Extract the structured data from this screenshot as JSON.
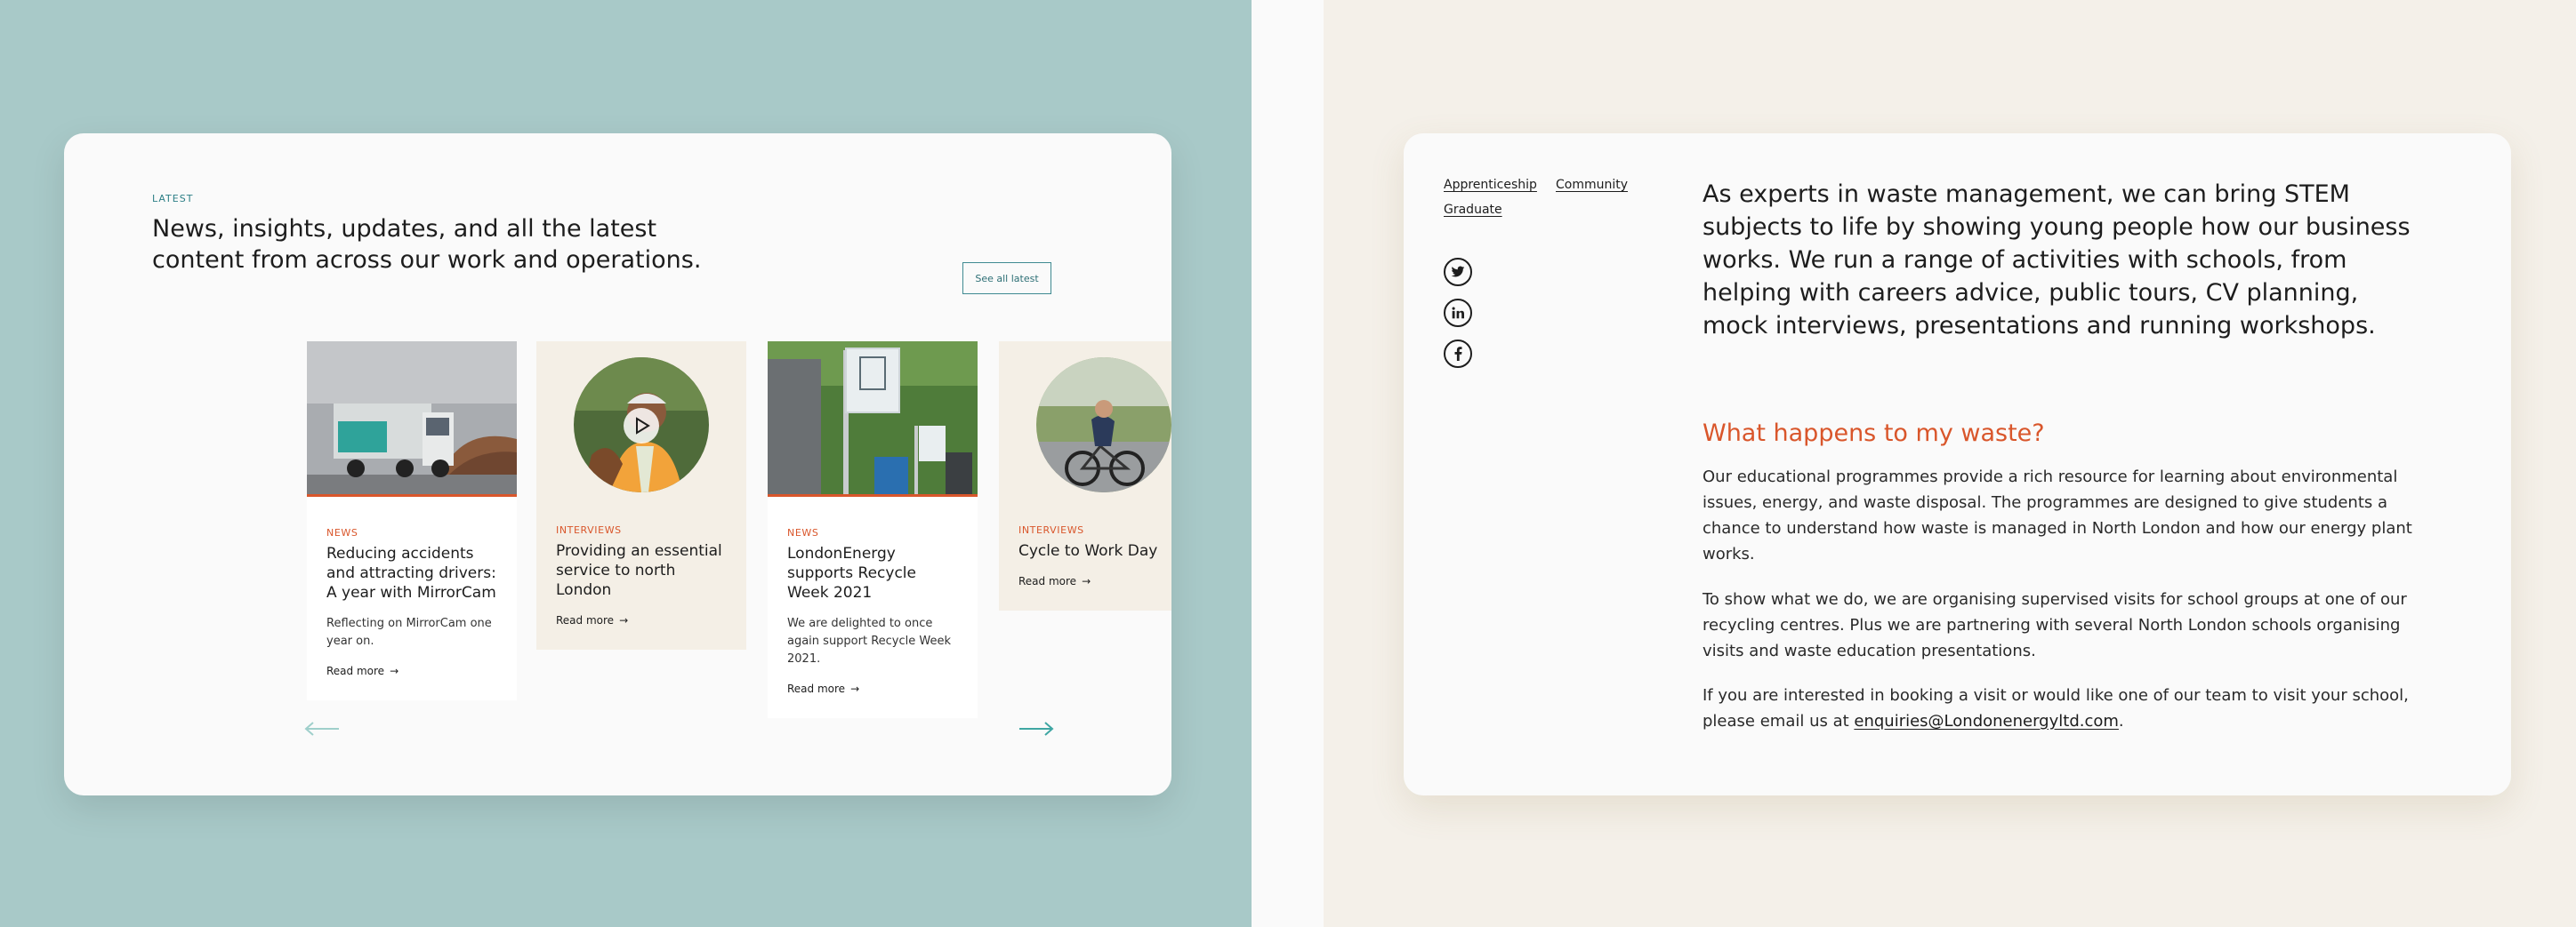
{
  "colors": {
    "teal_background": "#a8c9c8",
    "beige_background": "#f4f0e9",
    "accent_orange": "#d9562b",
    "accent_teal": "#2d7f86",
    "panel": "#fafafa"
  },
  "latest": {
    "eyebrow": "LATEST",
    "title": "News, insights, updates, and all the latest content from across our work and operations.",
    "see_all_label": "See all latest",
    "cards": [
      {
        "category": "NEWS",
        "title": "Reducing accidents and attracting drivers: A year with MirrorCam",
        "description": "Reflecting on MirrorCam one year on.",
        "read_more": "Read more",
        "image": "recycling-truck-photo"
      },
      {
        "category": "INTERVIEWS",
        "title": "Providing an essential service to north London",
        "read_more": "Read more",
        "image": "worker-portrait-photo"
      },
      {
        "category": "NEWS",
        "title": "LondonEnergy supports Recycle Week 2021",
        "description": "We are delighted to once again support Recycle Week 2021.",
        "read_more": "Read more",
        "image": "recycling-signs-photo"
      },
      {
        "category": "INTERVIEWS",
        "title": "Cycle to Work Day",
        "read_more": "Read more",
        "image": "cyclist-portrait-photo"
      }
    ],
    "prev_icon": "arrow-left-icon",
    "next_icon": "arrow-right-icon"
  },
  "education": {
    "tags": [
      "Apprenticeship",
      "Community",
      "Graduate"
    ],
    "social_icons": [
      "twitter-icon",
      "linkedin-icon",
      "facebook-icon"
    ],
    "intro": "As experts in waste management, we can bring STEM subjects to life by showing young people how our business works. We run a range of activities with schools, from helping with careers advice, public tours, CV planning, mock interviews, presentations and running workshops.",
    "subheading": "What happens to my waste?",
    "paragraph_1": "Our educational programmes provide a rich resource for learning about environmental issues, energy, and waste disposal. The programmes are designed to give students a chance to understand how waste is managed in North London and how our energy plant works.",
    "paragraph_2": "To show what we do, we are organising supervised visits for school groups at one of our recycling centres. Plus we are partnering with several North London schools organising visits and waste education presentations.",
    "paragraph_3_text": "If you are interested in booking a visit or would like one of our team to visit your school, please email us at ",
    "email": "enquiries@Londonenergyltd.com",
    "paragraph_3_end": "."
  }
}
